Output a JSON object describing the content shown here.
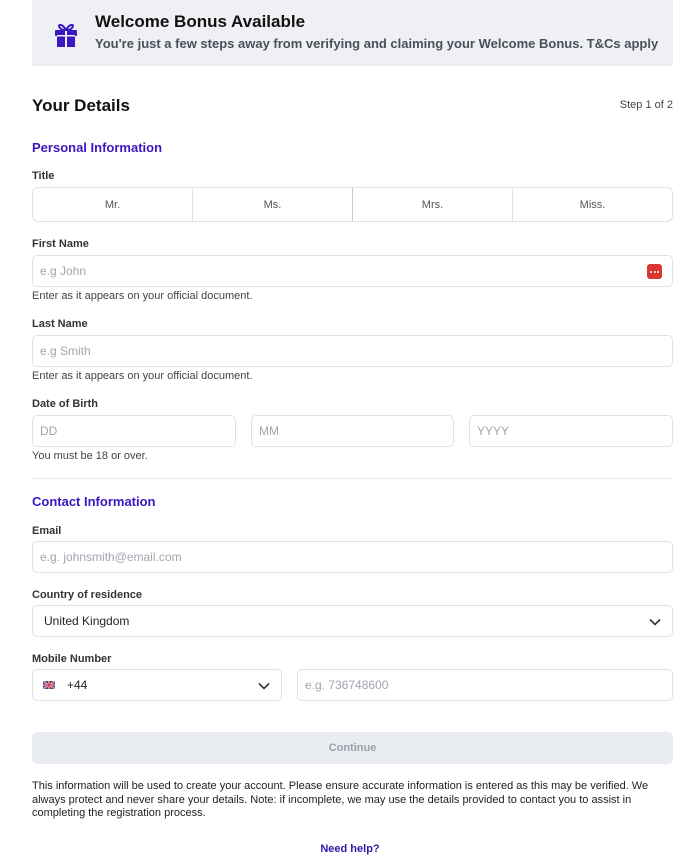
{
  "banner": {
    "title": "Welcome Bonus Available",
    "subtitle": "You're just a few steps away from verifying and claiming your Welcome Bonus. T&Cs apply",
    "icon": "gift-icon",
    "accent_color": "#3a17c0"
  },
  "header": {
    "heading": "Your Details",
    "step": "Step 1 of 2"
  },
  "personal": {
    "section_title": "Personal Information",
    "title_label": "Title",
    "title_options": [
      "Mr.",
      "Ms.",
      "Mrs.",
      "Miss."
    ],
    "first_name": {
      "label": "First Name",
      "placeholder": "e.g John",
      "hint": "Enter as it appears on your official document."
    },
    "last_name": {
      "label": "Last Name",
      "placeholder": "e.g Smith",
      "hint": "Enter as it appears on your official document."
    },
    "dob": {
      "label": "Date of Birth",
      "day_placeholder": "DD",
      "month_placeholder": "MM",
      "year_placeholder": "YYYY",
      "hint": "You must be 18 or over."
    }
  },
  "contact": {
    "section_title": "Contact Information",
    "email": {
      "label": "Email",
      "placeholder": "e.g. johnsmith@email.com"
    },
    "country": {
      "label": "Country of residence",
      "value": "United Kingdom"
    },
    "mobile": {
      "label": "Mobile Number",
      "dial_code": "+44",
      "flag": "uk-flag-icon",
      "placeholder": "e.g. 736748600"
    }
  },
  "actions": {
    "continue_label": "Continue",
    "notice": "This information will be used to create your account. Please ensure accurate information is entered as this may be verified. We always protect and never share your details. Note: if incomplete, we may use the details provided to contact you to assist in completing the registration process.",
    "help_label": "Need help?"
  }
}
